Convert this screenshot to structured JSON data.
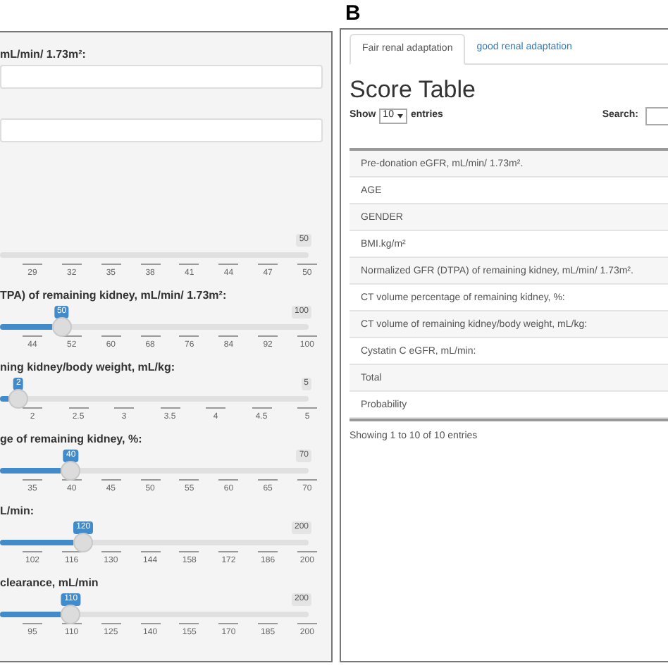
{
  "left_panel": {
    "fields": [
      {
        "kind": "input",
        "label": "mL/min/ 1.73m²:"
      },
      {
        "kind": "input"
      }
    ],
    "sliders": [
      {
        "max": "50",
        "ticks": [
          "29",
          "32",
          "35",
          "38",
          "41",
          "44",
          "47",
          "50"
        ]
      },
      {
        "label": "TPA) of remaining kidney, mL/min/ 1.73m²:",
        "value": "50",
        "max": "100",
        "level": 0.2,
        "ticks": [
          "44",
          "52",
          "60",
          "68",
          "76",
          "84",
          "92",
          "100"
        ]
      },
      {
        "label": "ning kidney/body weight, mL/kg:",
        "value": "2",
        "max": "5",
        "level": 0.06,
        "ticks": [
          "2",
          "2.5",
          "3",
          "3.5",
          "4",
          "4.5",
          "5"
        ]
      },
      {
        "label": "ge of remaining kidney, %:",
        "value": "40",
        "max": "70",
        "level": 0.23,
        "ticks": [
          "35",
          "40",
          "45",
          "50",
          "55",
          "60",
          "65",
          "70"
        ]
      },
      {
        "label": "L/min:",
        "value": "120",
        "max": "200",
        "level": 0.27,
        "ticks": [
          "102",
          "116",
          "130",
          "144",
          "158",
          "172",
          "186",
          "200"
        ]
      },
      {
        "label": "clearance, mL/min",
        "value": "110",
        "max": "200",
        "level": 0.23,
        "ticks": [
          "95",
          "110",
          "125",
          "140",
          "155",
          "170",
          "185",
          "200"
        ]
      }
    ]
  },
  "panel_label": "B",
  "right_panel": {
    "tabs": [
      {
        "label": "Fair renal adaptation",
        "selected": true
      },
      {
        "label": "good renal adaptation",
        "selected": false
      }
    ],
    "heading": "Score Table",
    "show_label": "Show",
    "page_size": "10",
    "entries_label": "entries",
    "search_label": "Search:",
    "rows": [
      "Pre-donation eGFR, mL/min/ 1.73m².",
      "AGE",
      "GENDER",
      "BMI.kg/m²",
      "Normalized GFR (DTPA) of remaining kidney, mL/min/ 1.73m².",
      "CT volume percentage of remaining kidney, %:",
      "CT volume of remaining kidney/body weight, mL/kg:",
      "Cystatin C eGFR, mL/min:",
      "Total",
      "Probability"
    ],
    "footer": "Showing 1 to 10 of 10 entries"
  }
}
